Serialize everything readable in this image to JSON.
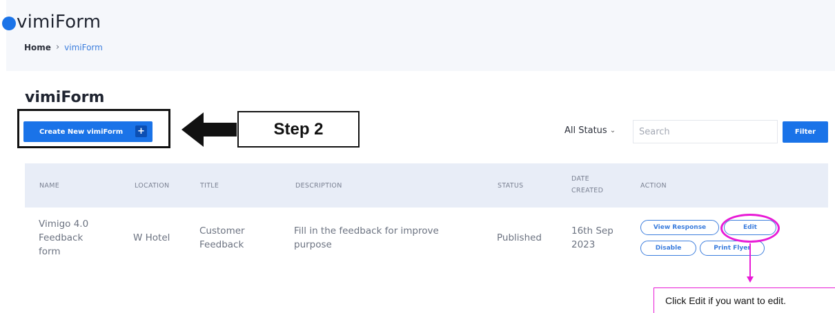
{
  "header": {
    "app_title": "vimiForm",
    "breadcrumb": {
      "home": "Home",
      "separator": "›",
      "current": "vimiForm"
    }
  },
  "page": {
    "title": "vimiForm",
    "create_button": {
      "label": "Create New vimiForm",
      "icon": "plus-icon",
      "glyph": "+"
    }
  },
  "annotations": {
    "step_label": "Step 2",
    "edit_hint": "Click Edit if you want to edit.",
    "annotation_color": "#e81bd6"
  },
  "filters": {
    "status_selected": "All Status",
    "search_placeholder": "Search",
    "filter_label": "Filter"
  },
  "table": {
    "headers": {
      "name": "NAME",
      "location": "LOCATION",
      "title": "TITLE",
      "description": "DESCRIPTION",
      "status": "STATUS",
      "date_created": "DATE CREATED",
      "action": "ACTION"
    },
    "rows": [
      {
        "name": "Vimigo 4.0 Feedback form",
        "location": "W Hotel",
        "title": "Customer Feedback",
        "description": "Fill in the feedback for improve purpose",
        "status": "Published",
        "date_created": "16th Sep 2023",
        "actions": {
          "view_response": "View Response",
          "edit": "Edit",
          "disable": "Disable",
          "print_flyer": "Print Flyer"
        }
      }
    ]
  },
  "colors": {
    "accent": "#1a73e8",
    "header_band": "#f5f7fb",
    "table_header": "#e8edf7"
  }
}
